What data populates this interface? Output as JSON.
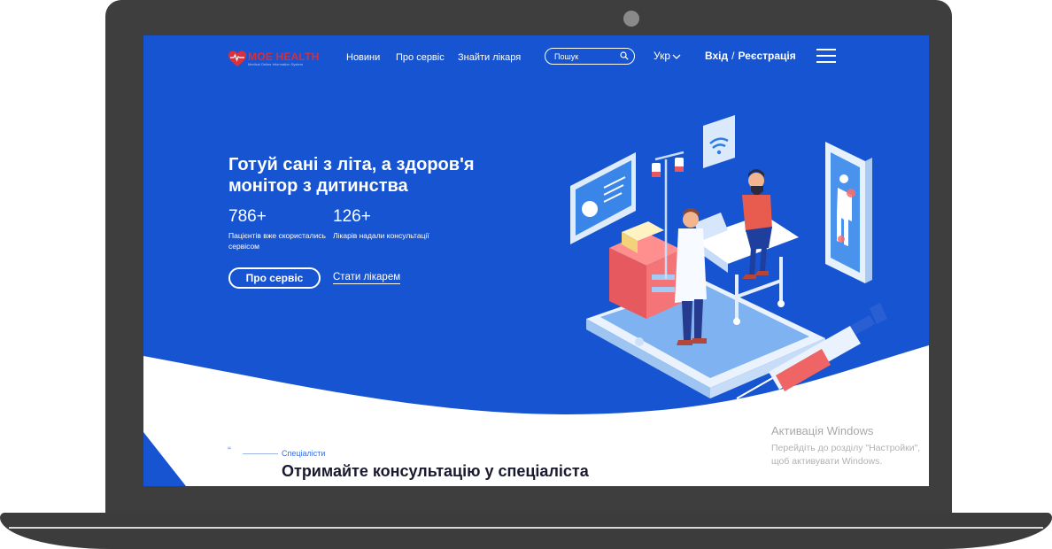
{
  "header": {
    "logo_text": "МОЕ HEALTH",
    "logo_subtitle": "Medical Online Information System",
    "nav": [
      "Новини",
      "Про сервіс",
      "Знайти лікаря"
    ],
    "search_placeholder": "Пошук",
    "language": "Укр",
    "login": "Вхід",
    "separator": "/",
    "register": "Реєстрація"
  },
  "hero": {
    "title": "Готуй сані з літа, а здоров'я монітор з дитинства",
    "stats": [
      {
        "value": "786+",
        "label": "Пацієнтів вже скористались сервісом"
      },
      {
        "value": "126+",
        "label": "Лікарів надали консультації"
      }
    ],
    "primary_button": "Про сервіс",
    "secondary_link": "Стати лікарем"
  },
  "section": {
    "quote_mark": "“",
    "tag": "Спеціалісти",
    "title": "Отримайте консультацію у спеціаліста"
  },
  "windows_activation": {
    "title": "Активація Windows",
    "text": "Перейдіть до розділу \"Настройки\", щоб активувати Windows."
  },
  "colors": {
    "hero_blue": "#1754d1",
    "laptop_body": "#3e3e3e",
    "accent_red": "#e8575c"
  },
  "icons": [
    "heart-logo-icon",
    "search-icon",
    "chevron-down-icon",
    "menu-icon",
    "wifi-icon"
  ]
}
